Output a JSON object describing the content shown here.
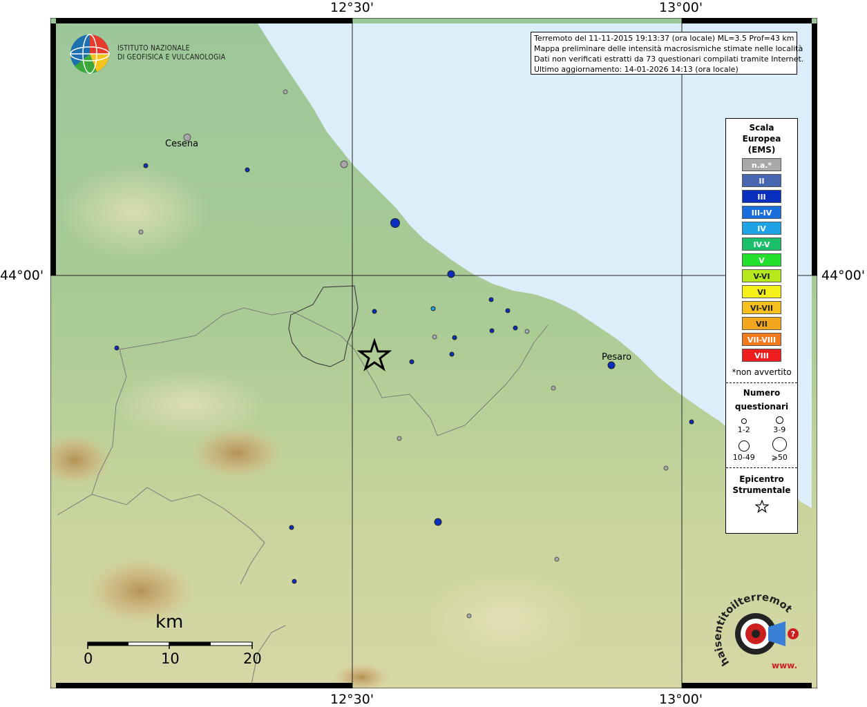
{
  "coordinates": {
    "top_left": "12°30'",
    "top_right": "13°00'",
    "bottom_left": "12°30'",
    "bottom_right": "13°00'",
    "side_left": "44°00'",
    "side_right": "44°00'"
  },
  "institute": {
    "line1": "ISTITUTO NAZIONALE",
    "line2": "DI GEOFISICA E VULCANOLOGIA"
  },
  "info": {
    "line1": "Terremoto del 11-11-2015 19:13:37 (ora locale) ML=3.5 Prof=43 km",
    "line2": "Mappa preliminare delle intensità macrosismiche stimate nelle località",
    "line3": "Dati non verificati estratti da 73 questionari compilati tramite Internet.",
    "line4": "Ultimo aggiornamento: 14-01-2026 14:13 (ora locale)"
  },
  "legend": {
    "title1": "Scala",
    "title2": "Europea",
    "title3": "(EMS)",
    "scale": [
      {
        "label": "n.a.*",
        "color": "#a8a8a8"
      },
      {
        "label": "II",
        "color": "#4766b0"
      },
      {
        "label": "III",
        "color": "#0a2fbf"
      },
      {
        "label": "III-IV",
        "color": "#1b6fdc"
      },
      {
        "label": "IV",
        "color": "#1ea3e6"
      },
      {
        "label": "IV-V",
        "color": "#1bbf6a"
      },
      {
        "label": "V",
        "color": "#22e02c"
      },
      {
        "label": "V-VI",
        "color": "#b6e81e"
      },
      {
        "label": "VI",
        "color": "#f6f01a"
      },
      {
        "label": "VI-VII",
        "color": "#f5c01e"
      },
      {
        "label": "VII",
        "color": "#f2a71e"
      },
      {
        "label": "VII-VIII",
        "color": "#f27a1e"
      },
      {
        "label": "VIII",
        "color": "#ee1e1e"
      }
    ],
    "note": "*non avvertito",
    "count_title1": "Numero",
    "count_title2": "questionari",
    "counts": [
      "1-2",
      "3-9",
      "10-49",
      "⩾50"
    ],
    "epi_title1": "Epicentro",
    "epi_title2": "Strumentale"
  },
  "cities": {
    "cesena": "Cesena",
    "pesaro": "Pesaro"
  },
  "scalebar": {
    "unit": "km",
    "labels": [
      "0",
      "10",
      "20"
    ]
  },
  "hs_logo": {
    "text": "haisentitoilterremoto.it",
    "url": "www."
  }
}
